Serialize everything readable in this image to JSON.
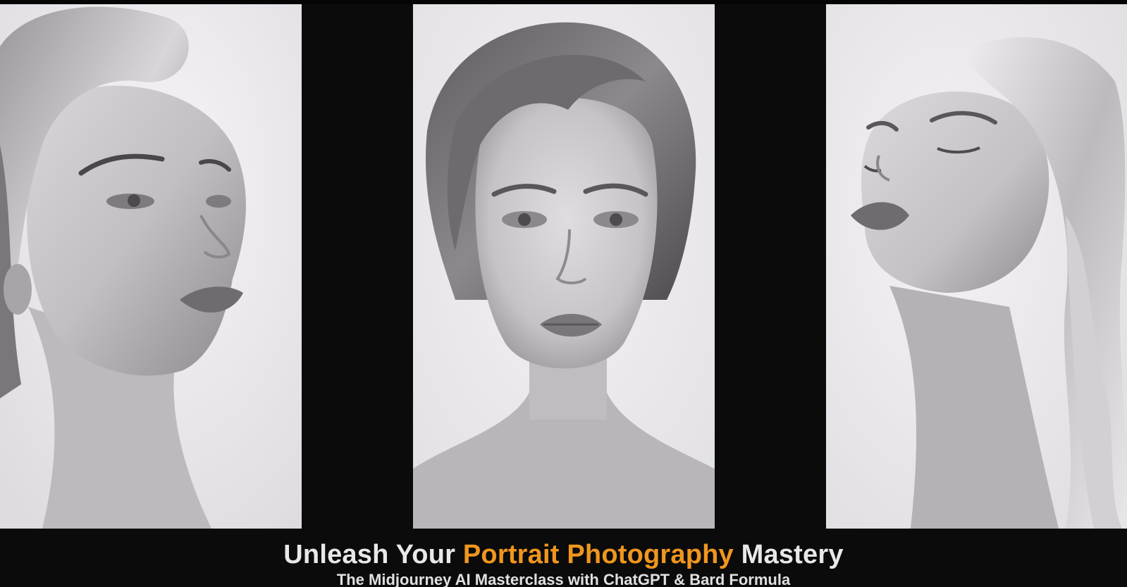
{
  "panels": [
    {
      "subject": "portrait-left",
      "style": "black-and-white",
      "pose": "looking-up-right"
    },
    {
      "subject": "portrait-center",
      "style": "black-and-white",
      "pose": "facing-camera"
    },
    {
      "subject": "portrait-right",
      "style": "black-and-white",
      "pose": "head-tilted-back-eyes-closed"
    }
  ],
  "caption": {
    "headline_part1": "Unleash Your ",
    "headline_highlight": "Portrait Photography",
    "headline_part2": " Mastery",
    "subline": "The Midjourney AI Masterclass with ChatGPT & Bard Formula"
  },
  "colors": {
    "background": "#0b0b0b",
    "headline_text": "#e8e8e8",
    "highlight": "#f0961e"
  }
}
